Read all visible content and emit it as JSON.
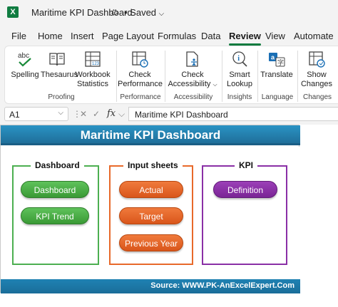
{
  "window": {
    "title": "Maritime KPI Dashboard",
    "status": "• Saved"
  },
  "tabs": [
    "File",
    "Home",
    "Insert",
    "Page Layout",
    "Formulas",
    "Data",
    "Review",
    "View",
    "Automate"
  ],
  "active_tab": "Review",
  "ribbon": {
    "spelling": "Spelling",
    "thesaurus": "Thesaurus",
    "workbook_stats_1": "Workbook",
    "workbook_stats_2": "Statistics",
    "check_perf_1": "Check",
    "check_perf_2": "Performance",
    "check_access_1": "Check",
    "check_access_2": "Accessibility",
    "smart_lookup_1": "Smart",
    "smart_lookup_2": "Lookup",
    "translate": "Translate",
    "show_changes_1": "Show",
    "show_changes_2": "Changes",
    "groups": {
      "proofing": "Proofing",
      "performance": "Performance",
      "accessibility": "Accessibility",
      "insights": "Insights",
      "language": "Language",
      "changes": "Changes"
    }
  },
  "formula_bar": {
    "cell": "A1",
    "fx": "fx",
    "content": "Maritime KPI Dashboard"
  },
  "dashboard": {
    "title": "Maritime KPI Dashboard",
    "source": "Source: WWW.PK-AnExcelExpert.Com",
    "sections": {
      "dashboard": {
        "label": "Dashboard",
        "buttons": [
          "Dashboard",
          "KPI Trend"
        ]
      },
      "input_sheets": {
        "label": "Input sheets",
        "buttons": [
          "Actual",
          "Target",
          "Previous Year"
        ]
      },
      "kpi": {
        "label": "KPI",
        "buttons": [
          "Definition"
        ]
      }
    }
  },
  "colors": {
    "excel_green": "#107c41",
    "title_blue": "#1f6f9a",
    "green": "#4caf50",
    "orange": "#e8692a",
    "purple": "#8a2fa6"
  }
}
